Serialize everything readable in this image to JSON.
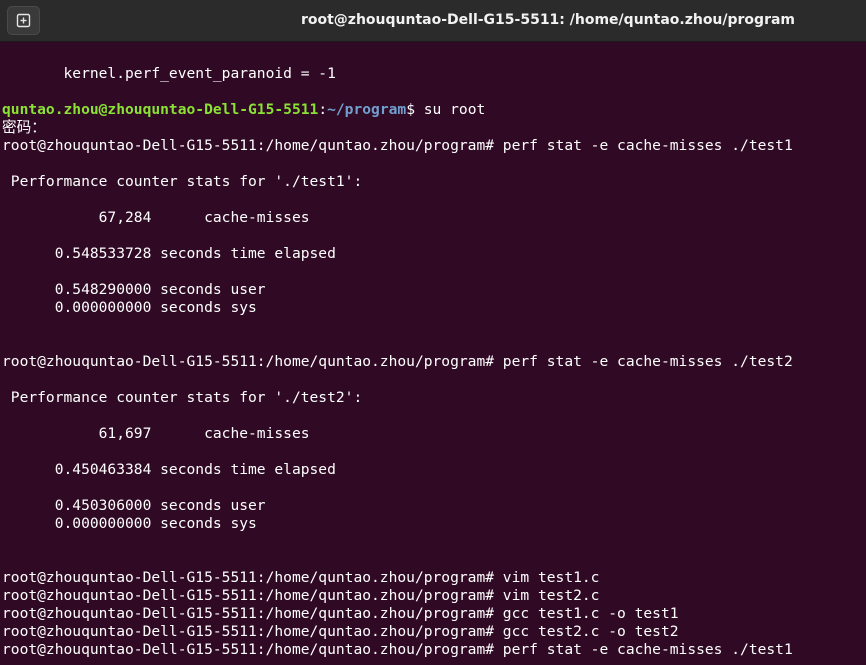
{
  "window": {
    "title": "root@zhouquntao-Dell-G15-5511: /home/quntao.zhou/program",
    "new_tab_icon": "new-tab-icon"
  },
  "terminal": {
    "lines": [
      {
        "text": "       kernel.perf_event_paranoid = -1"
      },
      {
        "user_host": "quntao.zhou@zhouquntao-Dell-G15-5511",
        "sep": ":",
        "path": "~/program",
        "rest": "$ su root"
      },
      {
        "text": "密码："
      },
      {
        "text": "root@zhouquntao-Dell-G15-5511:/home/quntao.zhou/program# perf stat -e cache-misses ./test1"
      },
      {
        "text": " Performance counter stats for './test1':"
      },
      {
        "text": "           67,284      cache-misses"
      },
      {
        "text": "      0.548533728 seconds time elapsed"
      },
      {
        "text": "      0.548290000 seconds user"
      },
      {
        "text": "      0.000000000 seconds sys"
      },
      {
        "text": "root@zhouquntao-Dell-G15-5511:/home/quntao.zhou/program# perf stat -e cache-misses ./test2"
      },
      {
        "text": " Performance counter stats for './test2':"
      },
      {
        "text": "           61,697      cache-misses"
      },
      {
        "text": "      0.450463384 seconds time elapsed"
      },
      {
        "text": "      0.450306000 seconds user"
      },
      {
        "text": "      0.000000000 seconds sys"
      },
      {
        "text": "root@zhouquntao-Dell-G15-5511:/home/quntao.zhou/program# vim test1.c"
      },
      {
        "text": "root@zhouquntao-Dell-G15-5511:/home/quntao.zhou/program# vim test2.c"
      },
      {
        "text": "root@zhouquntao-Dell-G15-5511:/home/quntao.zhou/program# gcc test1.c -o test1"
      },
      {
        "text": "root@zhouquntao-Dell-G15-5511:/home/quntao.zhou/program# gcc test2.c -o test2"
      },
      {
        "text": "root@zhouquntao-Dell-G15-5511:/home/quntao.zhou/program# perf stat -e cache-misses ./test1"
      }
    ]
  },
  "colors": {
    "background": "#300a24",
    "titlebar": "#2b2b2b",
    "prompt_user": "#8ae234",
    "prompt_path": "#729fcf",
    "text": "#ffffff"
  }
}
